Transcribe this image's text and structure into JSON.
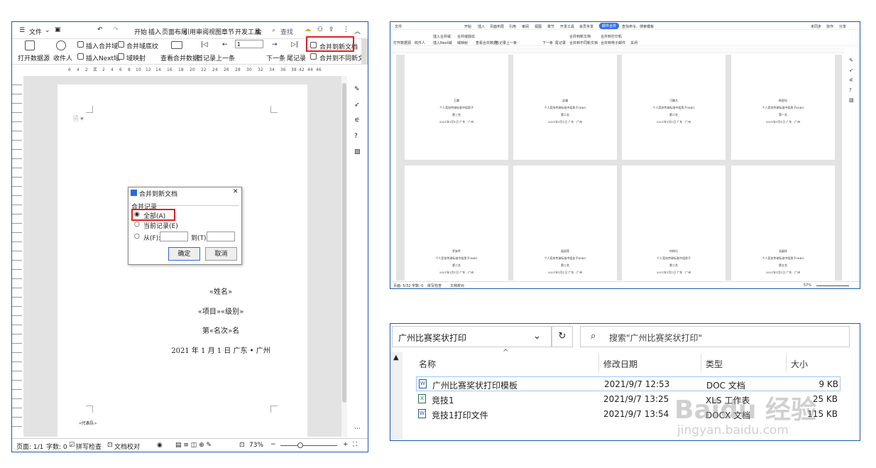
{
  "left": {
    "file_menu": "文件",
    "tabs": [
      "开始",
      "插入",
      "页面布局",
      "引用",
      "审阅",
      "视图",
      "章节",
      "开发工具",
      "会"
    ],
    "search": "查找",
    "ribbon": {
      "open_datasource": "打开数据源",
      "recipients": "收件人",
      "insert_merge_field": "插入合并域",
      "insert_next_field": "插入Next域",
      "merge_field_shading": "合并域底纹",
      "field_mapping": "域映射",
      "view_merged_data": "查看合并数据",
      "first_record": "首记录",
      "prev": "上一条",
      "record_value": "1",
      "next": "下一条",
      "last_record": "尾记录",
      "merge_to_new_doc": "合并到新文档",
      "merge_to_diff_new_doc": "合并到不同新文档"
    },
    "ruler_numbers": [
      "6",
      "4",
      "2",
      "2",
      "4",
      "6",
      "8",
      "10",
      "12",
      "14",
      "16",
      "18",
      "20",
      "22",
      "24",
      "26",
      "28",
      "30",
      "32",
      "34",
      "36",
      "38",
      "42",
      "44",
      "46"
    ],
    "doc_lines": [
      "«姓名»",
      "«项目»«级别»",
      "第«名次»名",
      "2021 年 1 月 1 日 广东 • 广州"
    ],
    "footer_text": "«代表队»",
    "dialog": {
      "title": "合并到新文档",
      "group": "合并记录",
      "opt_all": "全部(A)",
      "opt_current": "当前记录(E)",
      "opt_from": "从(F):",
      "opt_to": "到(T):",
      "ok": "确定",
      "cancel": "取消"
    },
    "status": {
      "page": "页面: 1/1",
      "words": "字数: 0",
      "spell": "拼写检查",
      "proof": "文档校对",
      "zoom": "73%"
    }
  },
  "right_top": {
    "tabs": [
      "文件",
      "开始",
      "插入",
      "页面布局",
      "引用",
      "审阅",
      "视图",
      "章节",
      "开发工具",
      "会员专享",
      "邮件合并"
    ],
    "active_tab": "邮件合并",
    "search": "查找命令、搜索模板",
    "share_labels": [
      "未同步",
      "协作",
      "分享"
    ],
    "ribbon_labels": [
      "打开数据源",
      "收件人",
      "插入合并域",
      "插入Next域",
      "合并域底纹",
      "域映射",
      "查看合并数据",
      "首记录",
      "上一条",
      "下一条",
      "尾记录",
      "合并到新文档",
      "合并到不同新文档",
      "合并到打印机",
      "合并到电子邮件",
      "关闭"
    ],
    "cards_top": [
      {
        "name": "王晨",
        "event": "个人竞技传球标准中组男子",
        "rank": "第三名",
        "date": "2021年1月1日 广东 · 广州"
      },
      {
        "name": "吴谦",
        "event": "个人竞技传球标准中组男子58KG",
        "rank": "第二名",
        "date": "2021年1月1日 广东 · 广州"
      },
      {
        "name": "习晨凡",
        "event": "个人竞技传球标准中组男子58KG",
        "rank": "第二名",
        "date": "2021年1月1日 广东 · 广州"
      },
      {
        "name": "杨思坦",
        "event": "个人竞技传球标准中组男子63KG",
        "rank": "第一名",
        "date": "2021年1月1日 广东 · 广州"
      }
    ],
    "cards_bottom": [
      {
        "name": "罗安怀",
        "event": "个人竞技传球标准中组男子58KG",
        "rank": "第二名",
        "date": "2021年1月1日 广东 · 广州"
      },
      {
        "name": "祖双莲",
        "event": "个人竞技传球标准中组女子45KG",
        "rank": "第二名",
        "date": "2021年1月1日 广东 · 广州"
      },
      {
        "name": "何梓乐",
        "event": "个人竞技传球标准中组男子",
        "rank": "第二名",
        "date": "2021年1月1日 广东 · 广州"
      },
      {
        "name": "吴嗣欣",
        "event": "个人竞技传球标准中组男子58KG",
        "rank": "第五名",
        "date": "2021年1月1日 广东 · 广州"
      }
    ],
    "footer_text": "«代表队»",
    "status": {
      "page": "页面: 5/32",
      "words": "字数: 0",
      "spell": "拼写检查",
      "proof": "文档校对",
      "zoom": "57%"
    }
  },
  "explorer": {
    "path": "广州比赛奖状打印",
    "search_placeholder": "搜索\"广州比赛奖状打印\"",
    "columns": [
      "名称",
      "修改日期",
      "类型",
      "大小"
    ],
    "files": [
      {
        "name": "广州比赛奖状打印模板",
        "date": "2021/9/7 12:53",
        "type": "DOC 文档",
        "size": "9 KB",
        "icon": "word",
        "color": "#2b579a"
      },
      {
        "name": "竞技1",
        "date": "2021/9/7 13:25",
        "type": "XLS 工作表",
        "size": "25 KB",
        "icon": "excel",
        "color": "#217346"
      },
      {
        "name": "竞技1打印文件",
        "date": "2021/9/7 13:54",
        "type": "DOCX 文档",
        "size": "115 KB",
        "icon": "word",
        "color": "#2b579a"
      }
    ]
  },
  "watermark": {
    "brand": "Baidu 经验",
    "url": "jingyan.baidu.com"
  }
}
